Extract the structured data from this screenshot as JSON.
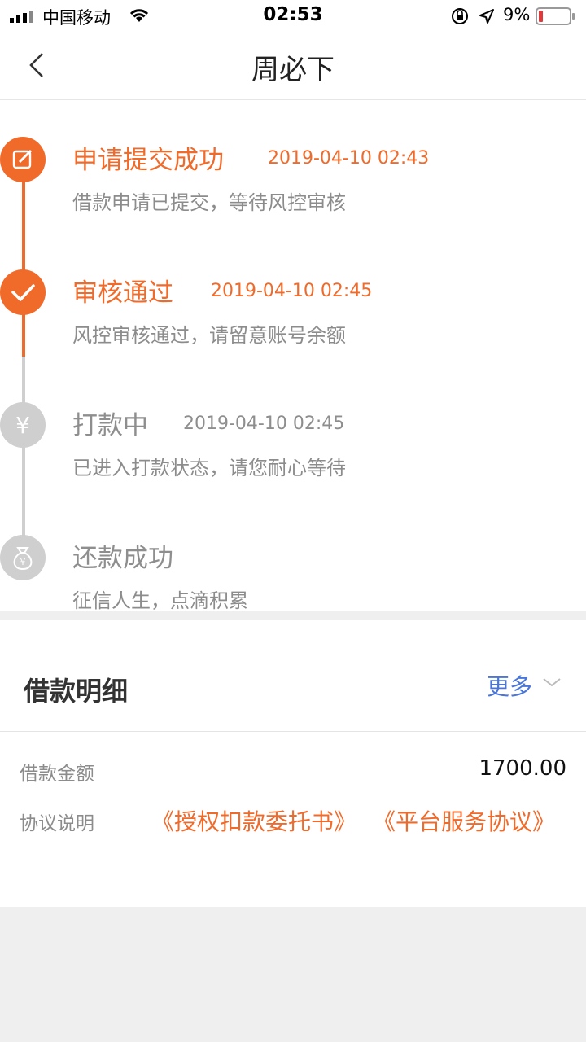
{
  "status_bar": {
    "carrier": "中国移动",
    "time": "02:53",
    "battery_percent": "9%"
  },
  "nav": {
    "title": "周必下"
  },
  "timeline": {
    "steps": [
      {
        "title": "申请提交成功",
        "time": "2019-04-10 02:43",
        "desc": "借款申请已提交，等待风控审核",
        "state": "done"
      },
      {
        "title": "审核通过",
        "time": "2019-04-10 02:45",
        "desc": "风控审核通过，请留意账号余额",
        "state": "done"
      },
      {
        "title": "打款中",
        "time": "2019-04-10 02:45",
        "desc": "已进入打款状态，请您耐心等待",
        "state": "pending"
      },
      {
        "title": "还款成功",
        "time": "",
        "desc": "征信人生，点滴积累",
        "state": "pending"
      }
    ]
  },
  "details": {
    "title": "借款明细",
    "more_label": "更多",
    "amount_label": "借款金额",
    "amount_value": "1700.00",
    "agreement_label": "协议说明",
    "agreements": [
      "《授权扣款委托书》",
      "《平台服务协议》"
    ]
  },
  "colors": {
    "accent": "#f06a2a",
    "link_blue": "#4a76d9",
    "inactive_gray": "#cfcfcf"
  }
}
